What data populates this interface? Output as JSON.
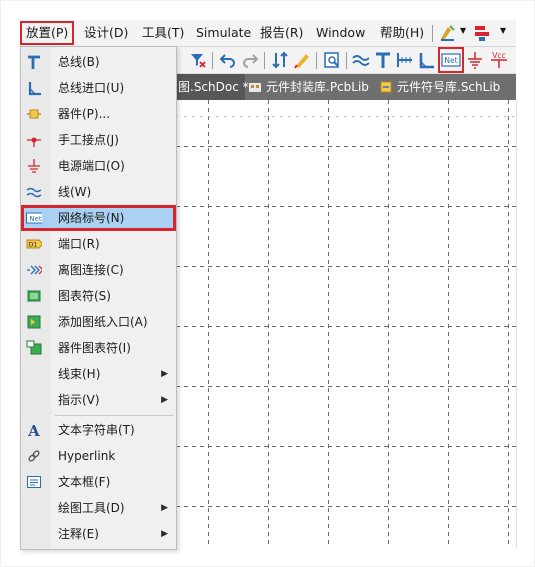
{
  "menubar": {
    "items": [
      {
        "label": "放置(P)"
      },
      {
        "label": "设计(D)"
      },
      {
        "label": "工具(T)"
      },
      {
        "label": "Simulate"
      },
      {
        "label": "报告(R)"
      },
      {
        "label": "Window"
      },
      {
        "label": "帮助(H)"
      }
    ]
  },
  "toolbar": {
    "net_label_text": "Net",
    "vcc_text": "Vcc"
  },
  "tabs": [
    {
      "label": "图.SchDoc *"
    },
    {
      "label": "元件封装库.PcbLib"
    },
    {
      "label": "元件符号库.SchLib"
    }
  ],
  "place_menu": {
    "items": [
      {
        "label": "总线(B)",
        "icon": "bus-icon"
      },
      {
        "label": "总线进口(U)",
        "icon": "bus-entry-icon"
      },
      {
        "label": "器件(P)...",
        "icon": "part-icon"
      },
      {
        "label": "手工接点(J)",
        "icon": "junction-icon"
      },
      {
        "label": "电源端口(O)",
        "icon": "power-port-icon"
      },
      {
        "label": "线(W)",
        "icon": "wire-icon"
      },
      {
        "label": "网络标号(N)",
        "icon": "net-label-icon",
        "icon_text": "Net"
      },
      {
        "label": "端口(R)",
        "icon": "port-icon",
        "icon_text": "D1"
      },
      {
        "label": "离图连接(C)",
        "icon": "off-sheet-connector-icon"
      },
      {
        "label": "图表符(S)",
        "icon": "sheet-symbol-icon"
      },
      {
        "label": "添加图纸入口(A)",
        "icon": "sheet-entry-icon"
      },
      {
        "label": "器件图表符(I)",
        "icon": "device-sheet-symbol-icon"
      },
      {
        "label": "线束(H)",
        "icon": "",
        "submenu": true
      },
      {
        "label": "指示(V)",
        "icon": "",
        "submenu": true
      },
      {
        "label": "文本字符串(T)",
        "icon": "text-string-icon",
        "icon_text": "A"
      },
      {
        "label": "Hyperlink",
        "icon": "hyperlink-icon"
      },
      {
        "label": "文本框(F)",
        "icon": "text-frame-icon"
      },
      {
        "label": "绘图工具(D)",
        "icon": "",
        "submenu": true
      },
      {
        "label": "注释(E)",
        "icon": "",
        "submenu": true
      }
    ]
  },
  "colors": {
    "highlight_red": "#d6252c",
    "selection_blue": "#aad1f1",
    "tab_gray": "#6f6f6f",
    "icon_blue": "#2a6db5"
  }
}
